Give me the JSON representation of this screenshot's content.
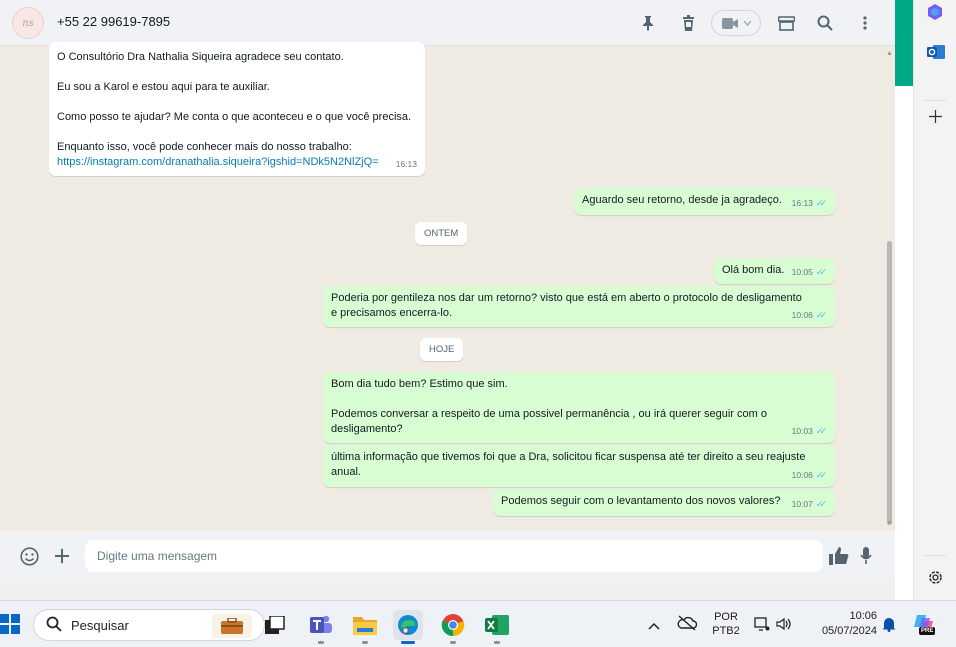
{
  "header": {
    "avatar_text": "ns",
    "contact_name": "+55 22 99619-7895"
  },
  "icons": {
    "pin": "pin-icon",
    "trash": "trash-icon",
    "video": "video-camera-icon",
    "shop": "store-icon",
    "search": "search-icon",
    "menu": "kebab-menu-icon"
  },
  "messages": [
    {
      "dir": "in",
      "text": "O Consultório Dra Nathalia Siqueira agradece seu contato.\n\nEu sou a Karol e estou aqui para te auxiliar.\n\nComo posso te ajudar? Me conta o que aconteceu e o que você precisa.\n\nEnquanto isso, você pode conhecer mais do nosso trabalho:",
      "link": "https://instagram.com/dranathalia.siqueira?igshid=NDk5N2NlZjQ=",
      "time": "16:13"
    },
    {
      "dir": "out",
      "text": "Aguardo seu retorno, desde ja agradeço.",
      "time": "16:13"
    },
    {
      "dir": "out",
      "text": "Olá bom dia.",
      "time": "10:05"
    },
    {
      "dir": "out",
      "text": "Poderia por gentileza nos dar um retorno? visto que está em aberto o protocolo de desligamento\ne precisamos encerra-lo.",
      "time": "10:06"
    },
    {
      "dir": "out",
      "text": "Bom dia tudo bem? Estimo que sim.\n\nPodemos conversar a respeito de uma possivel permanência , ou irá querer seguir com o\ndesligamento?",
      "time": "10:03"
    },
    {
      "dir": "out",
      "text": "última informação que tivemos foi que a Dra, solicitou ficar suspensa até ter direito a seu reajuste\nanual.",
      "time": "10:06"
    },
    {
      "dir": "out",
      "text": "Podemos seguir com o levantamento dos novos valores?",
      "time": "10:07"
    }
  ],
  "date_chips": [
    "ONTEM",
    "HOJE"
  ],
  "composer": {
    "placeholder": "Digite uma mensagem"
  },
  "taskbar": {
    "search_label": "Pesquisar",
    "lang_top": "POR",
    "lang_bottom": "PTB2",
    "time": "10:06",
    "date": "05/07/2024",
    "copilot_badge": "PRE"
  },
  "colors": {
    "incoming_bubble": "#ffffff",
    "outgoing_bubble": "#d9fdd3",
    "chat_background": "#efeae2",
    "accent": "#00a884",
    "read_ticks": "#53bdeb"
  }
}
